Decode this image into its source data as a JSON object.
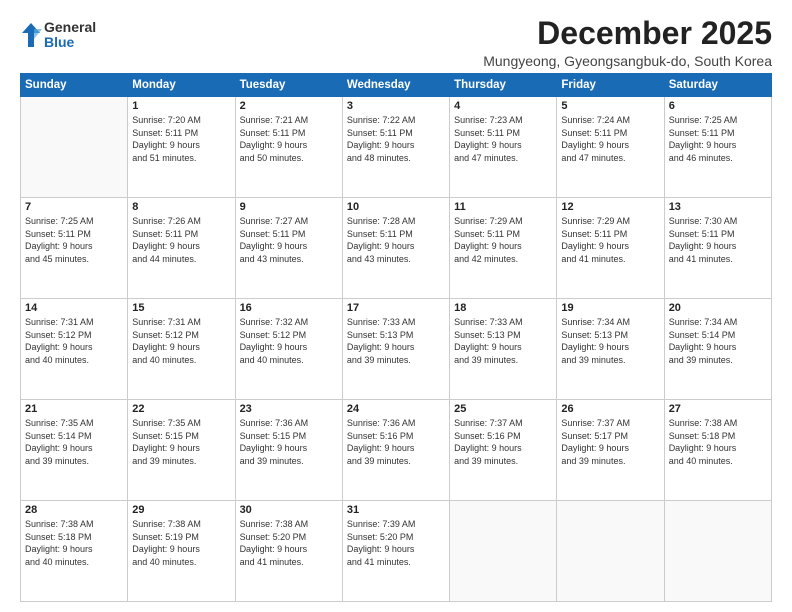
{
  "logo": {
    "general": "General",
    "blue": "Blue"
  },
  "title": "December 2025",
  "location": "Mungyeong, Gyeongsangbuk-do, South Korea",
  "headers": [
    "Sunday",
    "Monday",
    "Tuesday",
    "Wednesday",
    "Thursday",
    "Friday",
    "Saturday"
  ],
  "weeks": [
    [
      {
        "day": "",
        "info": ""
      },
      {
        "day": "1",
        "info": "Sunrise: 7:20 AM\nSunset: 5:11 PM\nDaylight: 9 hours\nand 51 minutes."
      },
      {
        "day": "2",
        "info": "Sunrise: 7:21 AM\nSunset: 5:11 PM\nDaylight: 9 hours\nand 50 minutes."
      },
      {
        "day": "3",
        "info": "Sunrise: 7:22 AM\nSunset: 5:11 PM\nDaylight: 9 hours\nand 48 minutes."
      },
      {
        "day": "4",
        "info": "Sunrise: 7:23 AM\nSunset: 5:11 PM\nDaylight: 9 hours\nand 47 minutes."
      },
      {
        "day": "5",
        "info": "Sunrise: 7:24 AM\nSunset: 5:11 PM\nDaylight: 9 hours\nand 47 minutes."
      },
      {
        "day": "6",
        "info": "Sunrise: 7:25 AM\nSunset: 5:11 PM\nDaylight: 9 hours\nand 46 minutes."
      }
    ],
    [
      {
        "day": "7",
        "info": "Sunrise: 7:25 AM\nSunset: 5:11 PM\nDaylight: 9 hours\nand 45 minutes."
      },
      {
        "day": "8",
        "info": "Sunrise: 7:26 AM\nSunset: 5:11 PM\nDaylight: 9 hours\nand 44 minutes."
      },
      {
        "day": "9",
        "info": "Sunrise: 7:27 AM\nSunset: 5:11 PM\nDaylight: 9 hours\nand 43 minutes."
      },
      {
        "day": "10",
        "info": "Sunrise: 7:28 AM\nSunset: 5:11 PM\nDaylight: 9 hours\nand 43 minutes."
      },
      {
        "day": "11",
        "info": "Sunrise: 7:29 AM\nSunset: 5:11 PM\nDaylight: 9 hours\nand 42 minutes."
      },
      {
        "day": "12",
        "info": "Sunrise: 7:29 AM\nSunset: 5:11 PM\nDaylight: 9 hours\nand 41 minutes."
      },
      {
        "day": "13",
        "info": "Sunrise: 7:30 AM\nSunset: 5:11 PM\nDaylight: 9 hours\nand 41 minutes."
      }
    ],
    [
      {
        "day": "14",
        "info": "Sunrise: 7:31 AM\nSunset: 5:12 PM\nDaylight: 9 hours\nand 40 minutes."
      },
      {
        "day": "15",
        "info": "Sunrise: 7:31 AM\nSunset: 5:12 PM\nDaylight: 9 hours\nand 40 minutes."
      },
      {
        "day": "16",
        "info": "Sunrise: 7:32 AM\nSunset: 5:12 PM\nDaylight: 9 hours\nand 40 minutes."
      },
      {
        "day": "17",
        "info": "Sunrise: 7:33 AM\nSunset: 5:13 PM\nDaylight: 9 hours\nand 39 minutes."
      },
      {
        "day": "18",
        "info": "Sunrise: 7:33 AM\nSunset: 5:13 PM\nDaylight: 9 hours\nand 39 minutes."
      },
      {
        "day": "19",
        "info": "Sunrise: 7:34 AM\nSunset: 5:13 PM\nDaylight: 9 hours\nand 39 minutes."
      },
      {
        "day": "20",
        "info": "Sunrise: 7:34 AM\nSunset: 5:14 PM\nDaylight: 9 hours\nand 39 minutes."
      }
    ],
    [
      {
        "day": "21",
        "info": "Sunrise: 7:35 AM\nSunset: 5:14 PM\nDaylight: 9 hours\nand 39 minutes."
      },
      {
        "day": "22",
        "info": "Sunrise: 7:35 AM\nSunset: 5:15 PM\nDaylight: 9 hours\nand 39 minutes."
      },
      {
        "day": "23",
        "info": "Sunrise: 7:36 AM\nSunset: 5:15 PM\nDaylight: 9 hours\nand 39 minutes."
      },
      {
        "day": "24",
        "info": "Sunrise: 7:36 AM\nSunset: 5:16 PM\nDaylight: 9 hours\nand 39 minutes."
      },
      {
        "day": "25",
        "info": "Sunrise: 7:37 AM\nSunset: 5:16 PM\nDaylight: 9 hours\nand 39 minutes."
      },
      {
        "day": "26",
        "info": "Sunrise: 7:37 AM\nSunset: 5:17 PM\nDaylight: 9 hours\nand 39 minutes."
      },
      {
        "day": "27",
        "info": "Sunrise: 7:38 AM\nSunset: 5:18 PM\nDaylight: 9 hours\nand 40 minutes."
      }
    ],
    [
      {
        "day": "28",
        "info": "Sunrise: 7:38 AM\nSunset: 5:18 PM\nDaylight: 9 hours\nand 40 minutes."
      },
      {
        "day": "29",
        "info": "Sunrise: 7:38 AM\nSunset: 5:19 PM\nDaylight: 9 hours\nand 40 minutes."
      },
      {
        "day": "30",
        "info": "Sunrise: 7:38 AM\nSunset: 5:20 PM\nDaylight: 9 hours\nand 41 minutes."
      },
      {
        "day": "31",
        "info": "Sunrise: 7:39 AM\nSunset: 5:20 PM\nDaylight: 9 hours\nand 41 minutes."
      },
      {
        "day": "",
        "info": ""
      },
      {
        "day": "",
        "info": ""
      },
      {
        "day": "",
        "info": ""
      }
    ]
  ]
}
